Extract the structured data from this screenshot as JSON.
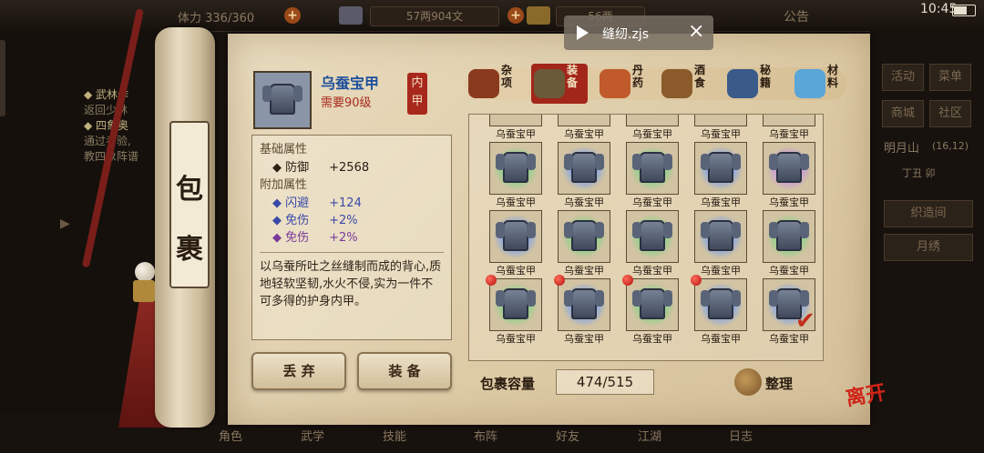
{
  "status_bar": {
    "time": "10:45"
  },
  "top_hud": {
    "stamina": "体力 336/360",
    "money": "57两904文",
    "gold": "56两",
    "announcement": "公告"
  },
  "notification": {
    "filename": "缝纫.zjs",
    "close": "×"
  },
  "left_quests": [
    {
      "title": "◆ 武林作",
      "desc": "返回少林"
    },
    {
      "title": "◆ 四象奥",
      "desc": "通过考验,\n教四象阵谱"
    }
  ],
  "right_menu": {
    "buttons": [
      "活动",
      "菜单",
      "商城",
      "社区"
    ],
    "location": "明月山",
    "coords": "(16,12)",
    "time_period": "丁丑 卯",
    "actions": [
      "织造间",
      "月绣"
    ]
  },
  "bottom_bar": [
    "角色",
    "武学",
    "技能",
    "布阵",
    "好友",
    "江湖",
    "日志"
  ],
  "roller": {
    "title_chars": [
      "包",
      "裹"
    ]
  },
  "item": {
    "name": "乌蚕宝甲",
    "requirement": "需要90级",
    "type_stamp": "内甲",
    "base_section": "基础属性",
    "base_attrs": [
      {
        "label": "防御",
        "value": "+2568"
      }
    ],
    "extra_section": "附加属性",
    "extra_attrs": [
      {
        "label": "闪避",
        "value": "+124",
        "color": "#3a4aa8"
      },
      {
        "label": "免伤",
        "value": "+2%",
        "color": "#3a4aa8"
      },
      {
        "label": "免伤",
        "value": "+2%",
        "color": "#7a3a9a"
      }
    ],
    "description": "以乌蚕所吐之丝缝制而成的背心,质地轻软坚韧,水火不侵,实为一件不可多得的护身内甲。"
  },
  "actions": {
    "discard": "丢 弃",
    "equip": "装 备"
  },
  "categories": [
    {
      "label": "杂项",
      "icon": "jar-icon",
      "active": false
    },
    {
      "label": "装备",
      "icon": "equipment-icon",
      "active": true
    },
    {
      "label": "丹药",
      "icon": "pill-icon",
      "active": false
    },
    {
      "label": "酒食",
      "icon": "wine-icon",
      "active": false
    },
    {
      "label": "秘籍",
      "icon": "book-icon",
      "active": false
    },
    {
      "label": "材料",
      "icon": "crystal-icon",
      "active": false
    }
  ],
  "grid": {
    "rows": [
      [
        {
          "name": "乌蚕宝甲",
          "glow": "none"
        },
        {
          "name": "乌蚕宝甲",
          "glow": "none"
        },
        {
          "name": "乌蚕宝甲",
          "glow": "none"
        },
        {
          "name": "乌蚕宝甲",
          "glow": "none"
        },
        {
          "name": "乌蚕宝甲",
          "glow": "none"
        }
      ],
      [
        {
          "name": "乌蚕宝甲",
          "glow": "green"
        },
        {
          "name": "乌蚕宝甲",
          "glow": "blue"
        },
        {
          "name": "乌蚕宝甲",
          "glow": "green"
        },
        {
          "name": "乌蚕宝甲",
          "glow": "blue"
        },
        {
          "name": "乌蚕宝甲",
          "glow": "purple"
        }
      ],
      [
        {
          "name": "乌蚕宝甲",
          "glow": "blue"
        },
        {
          "name": "乌蚕宝甲",
          "glow": "green"
        },
        {
          "name": "乌蚕宝甲",
          "glow": "green"
        },
        {
          "name": "乌蚕宝甲",
          "glow": "blue"
        },
        {
          "name": "乌蚕宝甲",
          "glow": "green"
        }
      ],
      [
        {
          "name": "乌蚕宝甲",
          "glow": "green",
          "new": true
        },
        {
          "name": "乌蚕宝甲",
          "glow": "blue",
          "new": true
        },
        {
          "name": "乌蚕宝甲",
          "glow": "green",
          "new": true
        },
        {
          "name": "乌蚕宝甲",
          "glow": "blue",
          "new": true
        },
        {
          "name": "乌蚕宝甲",
          "glow": "blue",
          "selected": true
        }
      ]
    ]
  },
  "capacity": {
    "label": "包裹容量",
    "value": "474/515"
  },
  "sort_label": "整理",
  "leave_label": "离开",
  "colors": {
    "green_glow": "#8fd08a",
    "blue_glow": "#8aa6e0",
    "purple_glow": "#c79ad8",
    "accent_red": "#a8281c",
    "item_name_blue": "#1c4f9e"
  }
}
